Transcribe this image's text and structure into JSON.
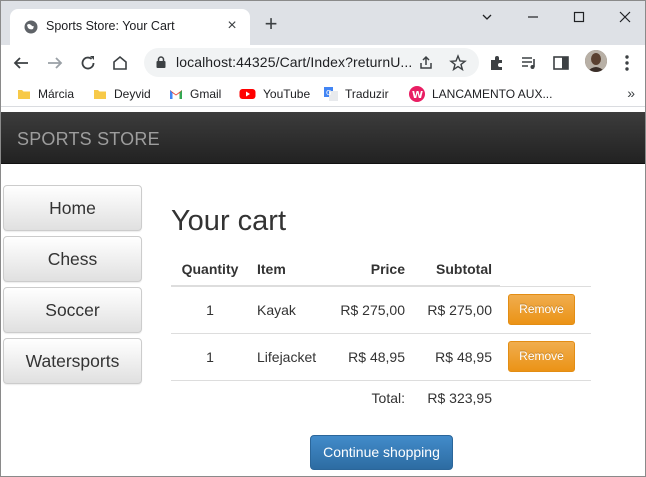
{
  "browser": {
    "tab_title": "Sports Store: Your Cart",
    "url": "localhost:44325/Cart/Index?returnU...",
    "bookmarks": [
      {
        "label": "Márcia",
        "icon": "folder-icon"
      },
      {
        "label": "Deyvid",
        "icon": "folder-icon"
      },
      {
        "label": "Gmail",
        "icon": "gmail-icon"
      },
      {
        "label": "YouTube",
        "icon": "youtube-icon"
      },
      {
        "label": "Traduzir",
        "icon": "translate-icon"
      },
      {
        "label": "LANCAMENTO AUX...",
        "icon": "app-icon"
      }
    ]
  },
  "site": {
    "brand": "SPORTS STORE",
    "categories": [
      "Home",
      "Chess",
      "Soccer",
      "Watersports"
    ]
  },
  "cart": {
    "heading": "Your cart",
    "columns": {
      "quantity": "Quantity",
      "item": "Item",
      "price": "Price",
      "subtotal": "Subtotal"
    },
    "rows": [
      {
        "quantity": "1",
        "item": "Kayak",
        "price": "R$ 275,00",
        "subtotal": "R$ 275,00",
        "action": "Remove"
      },
      {
        "quantity": "1",
        "item": "Lifejacket",
        "price": "R$ 48,95",
        "subtotal": "R$ 48,95",
        "action": "Remove"
      }
    ],
    "total_label": "Total:",
    "total_value": "R$ 323,95",
    "continue_label": "Continue shopping"
  },
  "colors": {
    "navbar": "#222222",
    "remove_button": "#f0ad4e",
    "continue_button": "#428bca"
  }
}
